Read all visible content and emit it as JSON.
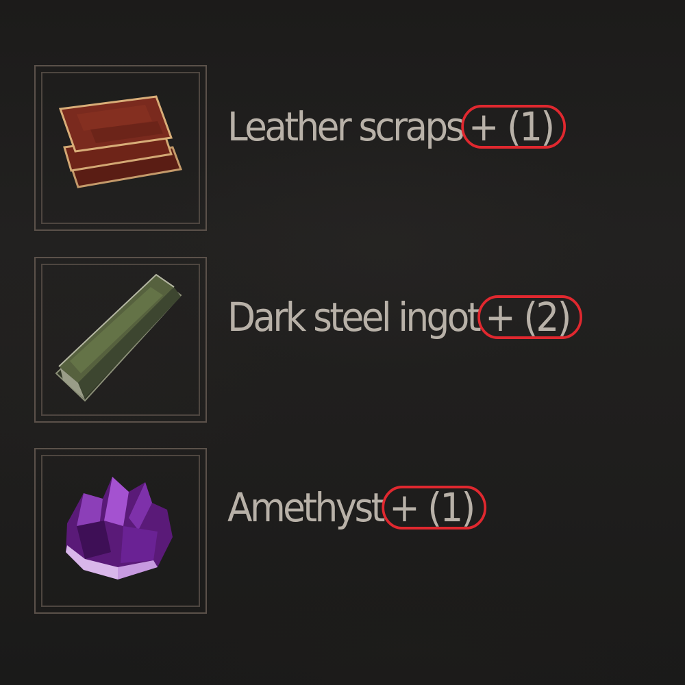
{
  "items": [
    {
      "name": "Leather scraps",
      "quantity": "+ (1)",
      "icon": "leather-scraps-icon"
    },
    {
      "name": "Dark steel ingot",
      "quantity": "+ (2)",
      "icon": "dark-steel-ingot-icon"
    },
    {
      "name": "Amethyst",
      "quantity": "+ (1)",
      "icon": "amethyst-icon"
    }
  ],
  "colors": {
    "text": "#b8b1a8",
    "frame": "#5b514a",
    "highlight": "#e0282f",
    "background": "#1f1e1d"
  }
}
